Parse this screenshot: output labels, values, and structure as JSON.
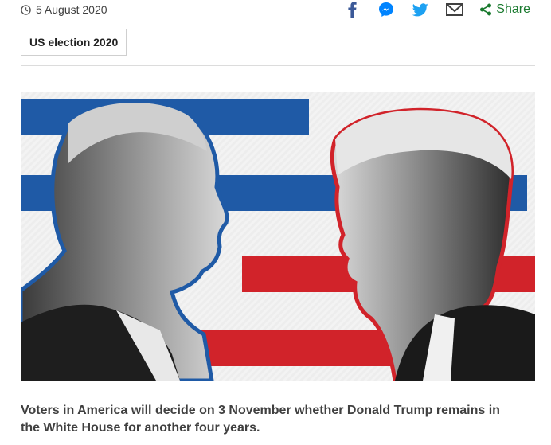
{
  "article": {
    "date": "5 August 2020",
    "tag": "US election 2020",
    "intro": "Voters in America will decide on 3 November whether Donald Trump remains in the White House for another four years."
  },
  "share": {
    "label": "Share",
    "tools": [
      {
        "name": "facebook-icon",
        "color": "#3b5998"
      },
      {
        "name": "messenger-icon",
        "color": "#0084ff"
      },
      {
        "name": "twitter-icon",
        "color": "#1da1f2"
      },
      {
        "name": "email-icon",
        "color": "#404040"
      }
    ],
    "accent": "#1a7a2f"
  },
  "hero": {
    "colors": {
      "blue": "#1f5aa6",
      "red": "#d1232a",
      "background": "#f3f3f3"
    }
  }
}
